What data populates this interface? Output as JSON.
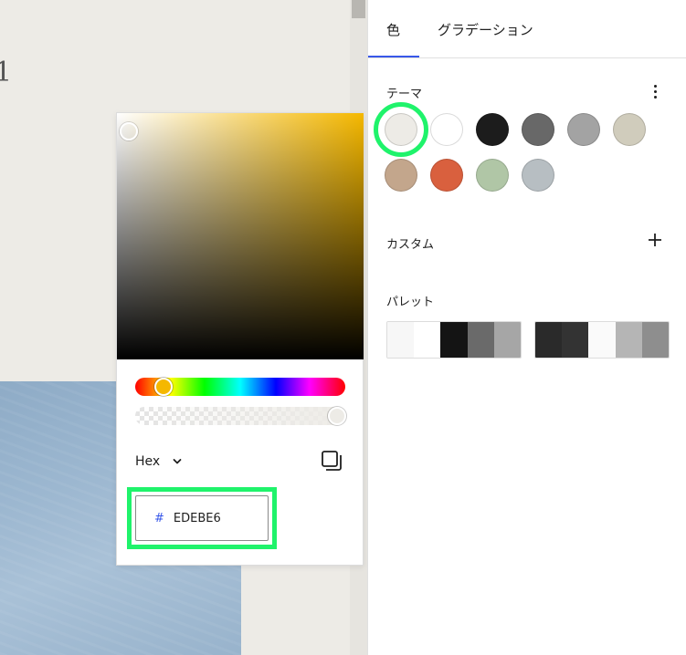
{
  "canvas": {
    "background_color": "#edebe6",
    "glyph": "1"
  },
  "picker": {
    "format_label": "Hex",
    "format_chevron_icon": "chevron-down-icon",
    "copy_icon": "copy-icon",
    "hex_prefix": "#",
    "hex_value": "EDEBE6",
    "base_hue_color": "#f5b800",
    "hue_handle_color": "#f5b800",
    "selected_color": "#edebe6",
    "highlight_color": "#1ff36b"
  },
  "tabs": [
    {
      "label": "色",
      "active": true
    },
    {
      "label": "グラデーション",
      "active": false
    }
  ],
  "theme": {
    "label": "テーマ",
    "menu_icon": "more-vertical-icon",
    "swatches": [
      {
        "color": "#edebe6",
        "selected": true
      },
      {
        "color": "#ffffff",
        "selected": false
      },
      {
        "color": "#1c1c1c",
        "selected": false
      },
      {
        "color": "#686868",
        "selected": false
      },
      {
        "color": "#a3a3a3",
        "selected": false
      },
      {
        "color": "#d0ccbc",
        "selected": false
      },
      {
        "color": "#c3a68c",
        "selected": false
      },
      {
        "color": "#d9603e",
        "selected": false
      },
      {
        "color": "#b0c6a6",
        "selected": false
      },
      {
        "color": "#b7bec2",
        "selected": false
      }
    ]
  },
  "custom": {
    "label": "カスタム",
    "add_icon": "plus-icon"
  },
  "palettes": {
    "label": "パレット",
    "items": [
      {
        "colors": [
          "#f7f7f7",
          "#ffffff",
          "#141414",
          "#6a6a6a",
          "#a6a6a6"
        ]
      },
      {
        "colors": [
          "#2a2a2a",
          "#333333",
          "#fafafa",
          "#b5b5b5",
          "#8e8e8e"
        ]
      }
    ]
  }
}
